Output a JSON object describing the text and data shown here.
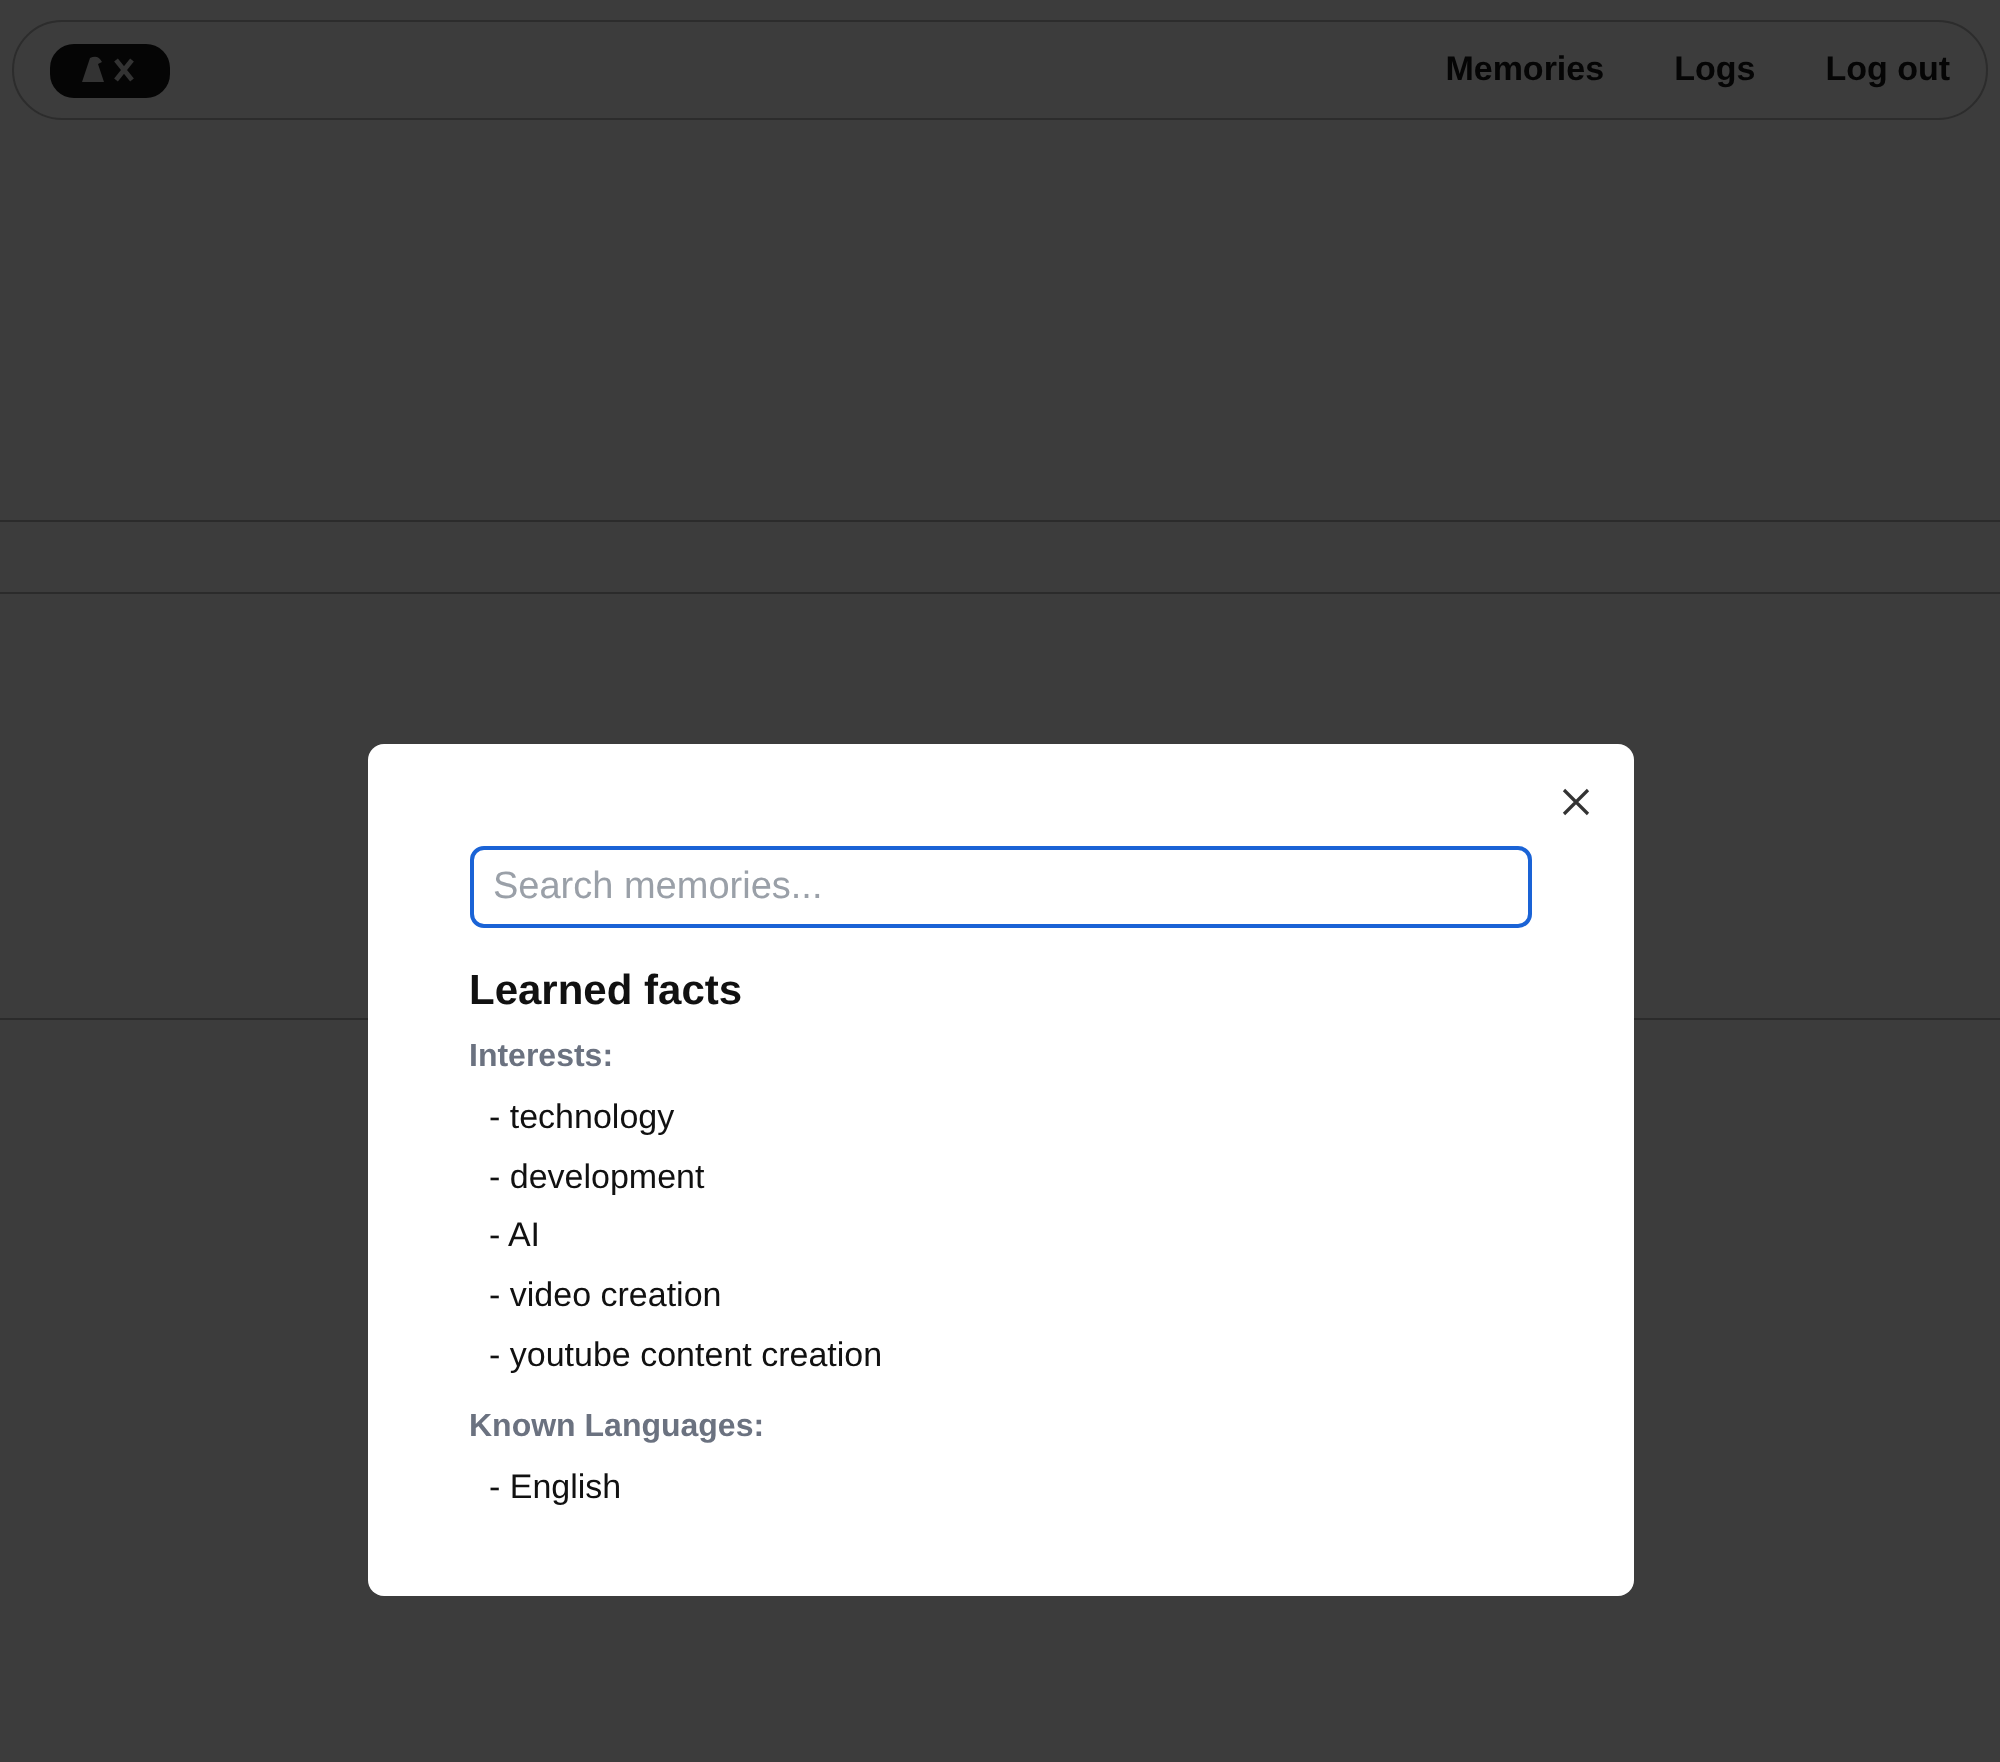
{
  "nav": {
    "links": [
      "Memories",
      "Logs",
      "Log out"
    ]
  },
  "modal": {
    "search": {
      "placeholder": "Search memories..."
    },
    "title": "Learned facts",
    "groups": [
      {
        "label": "Interests:",
        "items": [
          "- technology",
          "- development",
          "- AI",
          "- video creation",
          "- youtube content creation"
        ]
      },
      {
        "label": "Known Languages:",
        "items": [
          "- English"
        ]
      }
    ]
  }
}
